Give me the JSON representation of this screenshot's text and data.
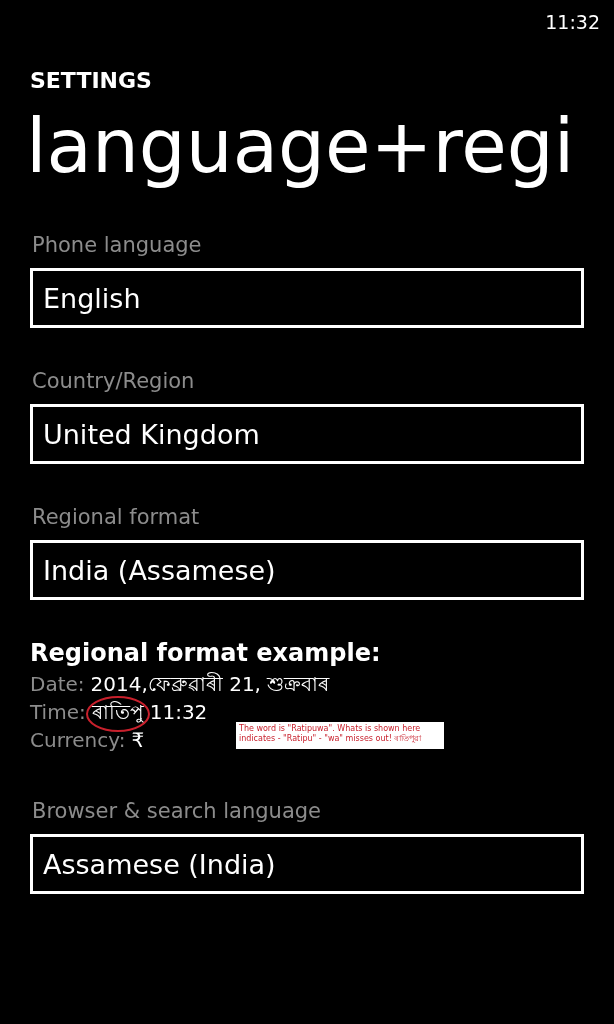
{
  "status_bar": {
    "time": "11:32"
  },
  "header": {
    "app": "SETTINGS",
    "title": "language+regi"
  },
  "sections": [
    {
      "kind": "picker",
      "label": "Phone language",
      "value": "English"
    },
    {
      "kind": "picker",
      "label": "Country/Region",
      "value": "United Kingdom"
    },
    {
      "kind": "picker",
      "label": "Regional format",
      "value": "India (Assamese)"
    },
    {
      "kind": "example",
      "heading": "Regional format example:",
      "rows": [
        {
          "label": "Date:",
          "value": "2014,ফেব্ৰুৱাৰী 21, শুক্ৰবাৰ",
          "circled": false
        },
        {
          "label": "Time:",
          "value": "ৰাতিপু",
          "extra": "11:32",
          "circled": true
        },
        {
          "label": "Currency:",
          "value": "₹",
          "circled": false
        }
      ],
      "note": "The word is \"Ratipuwa\". Whats is shown here indicates - \"Ratipu\" - \"wa\" misses out! ৰাতিপুৱা"
    },
    {
      "kind": "picker",
      "label": "Browser & search language",
      "value": "Assamese (India)"
    }
  ]
}
